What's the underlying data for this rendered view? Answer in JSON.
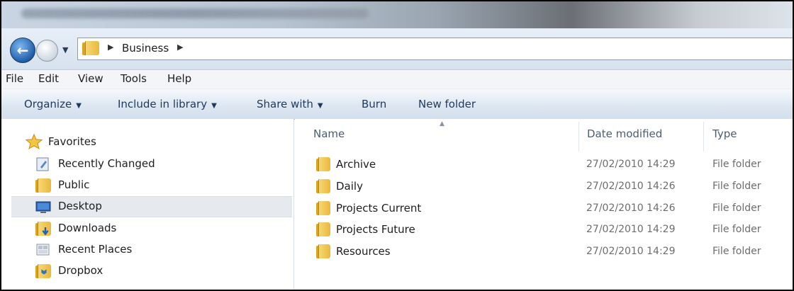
{
  "window": {
    "title_obscured": true
  },
  "address_bar": {
    "crumbs": [
      "Business"
    ]
  },
  "menu_bar": [
    "File",
    "Edit",
    "View",
    "Tools",
    "Help"
  ],
  "command_bar": {
    "organize": "Organize",
    "include_in_library": "Include in library",
    "share_with": "Share with",
    "burn": "Burn",
    "new_folder": "New folder"
  },
  "nav_pane": {
    "favorites_label": "Favorites",
    "items": [
      {
        "label": "Recently Changed",
        "icon": "recently-changed-icon"
      },
      {
        "label": "Public",
        "icon": "folder-icon"
      },
      {
        "label": "Desktop",
        "icon": "desktop-icon",
        "selected": true
      },
      {
        "label": "Downloads",
        "icon": "downloads-icon"
      },
      {
        "label": "Recent Places",
        "icon": "recent-places-icon"
      },
      {
        "label": "Dropbox",
        "icon": "dropbox-folder-icon"
      }
    ]
  },
  "file_list": {
    "columns": {
      "name": "Name",
      "date_modified": "Date modified",
      "type": "Type"
    },
    "rows": [
      {
        "name": "Archive",
        "date": "27/02/2010 14:29",
        "type": "File folder"
      },
      {
        "name": "Daily",
        "date": "27/02/2010 14:26",
        "type": "File folder"
      },
      {
        "name": "Projects Current",
        "date": "27/02/2010 14:26",
        "type": "File folder"
      },
      {
        "name": "Projects Future",
        "date": "27/02/2010 14:29",
        "type": "File folder"
      },
      {
        "name": "Resources",
        "date": "27/02/2010 14:29",
        "type": "File folder"
      }
    ]
  },
  "colors": {
    "command_text": "#1e395b",
    "secondary_text": "#6d6d6d",
    "selection_bg": "#e6e9ee"
  }
}
